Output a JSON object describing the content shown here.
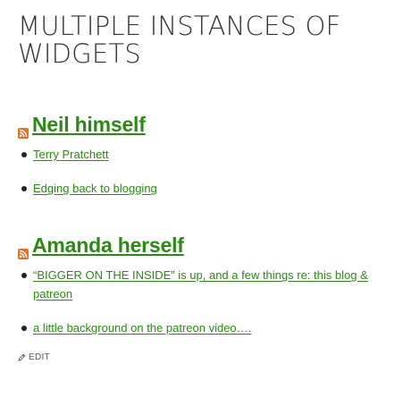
{
  "page": {
    "title": "MULTIPLE INSTANCES OF WIDGETS"
  },
  "widgets": [
    {
      "title": "Neil himself",
      "icon": "rss-feed-icon",
      "items": [
        {
          "label": "Terry Pratchett"
        },
        {
          "label": "Edging back to blogging"
        }
      ]
    },
    {
      "title": "Amanda herself",
      "icon": "rss-feed-icon",
      "items": [
        {
          "label": "“BIGGER ON THE INSIDE” is up, and a few things re: this blog & patreon"
        },
        {
          "label": "a little background on the patreon video…."
        }
      ]
    }
  ],
  "edit": {
    "label": "EDIT",
    "icon": "pencil-icon"
  },
  "colors": {
    "link": "#2b8a14",
    "rss": "#e2702a",
    "text": "#333333"
  }
}
